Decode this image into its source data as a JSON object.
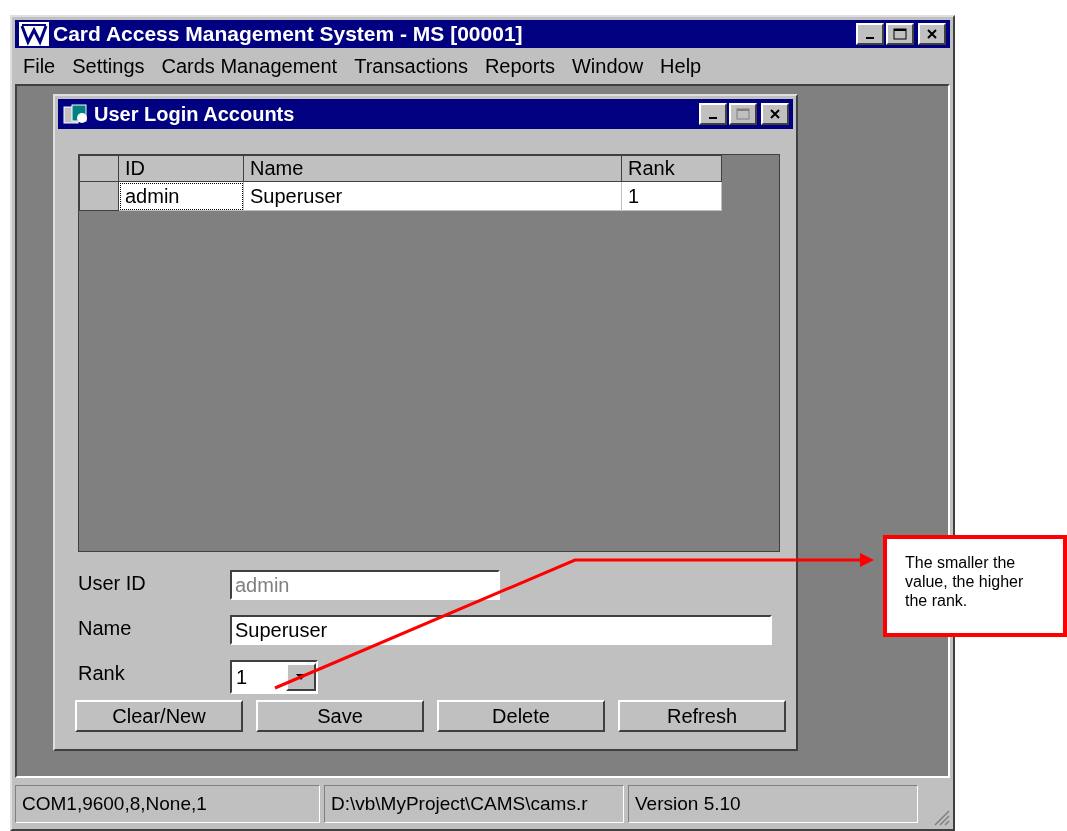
{
  "window": {
    "title": "Card Access Management System - MS [00001]"
  },
  "menu": [
    "File",
    "Settings",
    "Cards Management",
    "Transactions",
    "Reports",
    "Window",
    "Help"
  ],
  "child_window": {
    "title": "User Login Accounts",
    "grid": {
      "columns": [
        "ID",
        "Name",
        "Rank"
      ],
      "rows": [
        {
          "cells": [
            "admin",
            "Superuser",
            "1"
          ],
          "selected": true
        }
      ]
    },
    "form": {
      "user_id": {
        "label": "User ID",
        "value": "admin",
        "disabled": true
      },
      "name": {
        "label": "Name",
        "value": "Superuser",
        "disabled": false
      },
      "rank": {
        "label": "Rank",
        "value": "1"
      }
    },
    "buttons": [
      "Clear/New",
      "Save",
      "Delete",
      "Refresh"
    ]
  },
  "status_bar": [
    "COM1,9600,8,None,1",
    "D:\\vb\\MyProject\\CAMS\\cams.r",
    "Version 5.10"
  ],
  "callout": {
    "text": "The smaller the value, the higher the rank."
  }
}
